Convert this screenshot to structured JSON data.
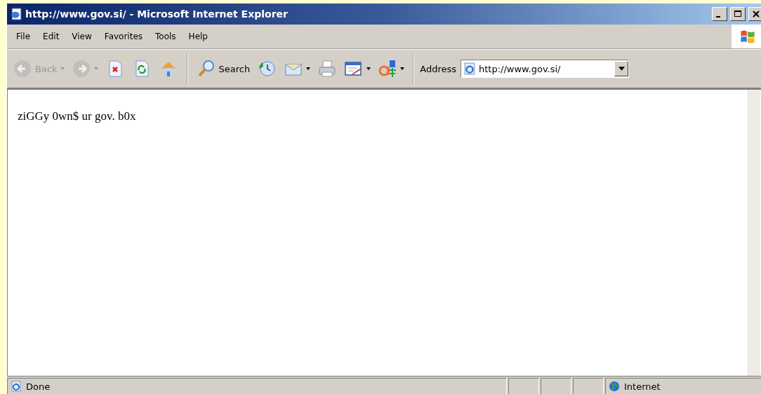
{
  "window": {
    "title": "http://www.gov.si/ - Microsoft Internet Explorer"
  },
  "menu": [
    {
      "label": "File"
    },
    {
      "label": "Edit"
    },
    {
      "label": "View"
    },
    {
      "label": "Favorites"
    },
    {
      "label": "Tools"
    },
    {
      "label": "Help"
    }
  ],
  "toolbar": [
    {
      "kind": "back",
      "label": "Back",
      "disabled": true,
      "dropdown": true
    },
    {
      "kind": "forward",
      "disabled": true,
      "dropdown": true
    },
    {
      "kind": "stop",
      "disabled": false,
      "dropdown": false
    },
    {
      "kind": "refresh",
      "disabled": false,
      "dropdown": false
    },
    {
      "kind": "home",
      "disabled": false,
      "dropdown": false
    },
    {
      "kind": "separator"
    },
    {
      "kind": "search",
      "label": "Search",
      "disabled": false,
      "dropdown": false
    },
    {
      "kind": "history",
      "disabled": false,
      "dropdown": false
    },
    {
      "kind": "mail",
      "disabled": false,
      "dropdown": true
    },
    {
      "kind": "print",
      "disabled": false,
      "dropdown": false
    },
    {
      "kind": "edit",
      "disabled": false,
      "dropdown": true
    },
    {
      "kind": "encoding",
      "disabled": false,
      "dropdown": true
    }
  ],
  "address": {
    "label": "Address",
    "value": "http://www.gov.si/"
  },
  "page": {
    "text": "ziGGy 0wn$ ur gov. b0x"
  },
  "status_bar": {
    "text": "Done",
    "zone": "Internet"
  }
}
